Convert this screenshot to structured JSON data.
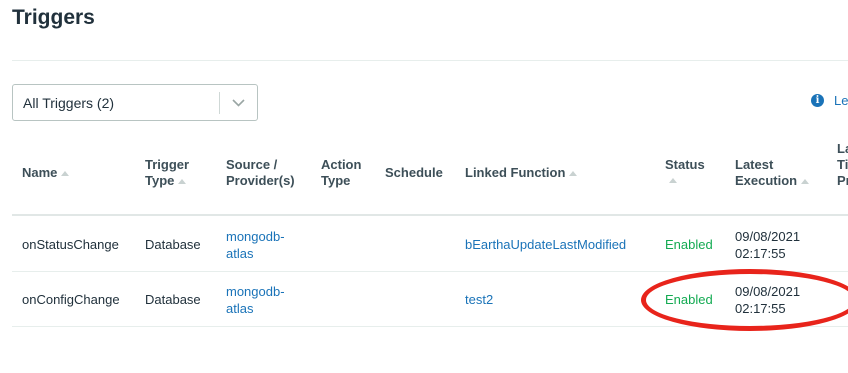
{
  "page": {
    "title": "Triggers"
  },
  "filter": {
    "selected": "All Triggers (2)"
  },
  "info": {
    "link_text": "Le"
  },
  "table": {
    "columns": {
      "name": "Name",
      "trigger_type": [
        "Trigger",
        "Type"
      ],
      "source": [
        "Source /",
        "Provider(s)"
      ],
      "action_type": [
        "Action",
        "Type"
      ],
      "schedule": "Schedule",
      "linked_function": "Linked Function",
      "status": "Status",
      "latest_execution": [
        "Latest",
        "Execution"
      ],
      "last_col": [
        "La",
        "Ti",
        "Pr"
      ]
    },
    "rows": [
      {
        "name": "onStatusChange",
        "type": "Database",
        "source": [
          "mongodb-",
          "atlas"
        ],
        "action_type": "",
        "schedule": "",
        "linked_function": "bEarthaUpdateLastModified",
        "status": "Enabled",
        "latest_execution": [
          "09/08/2021",
          "02:17:55"
        ]
      },
      {
        "name": "onConfigChange",
        "type": "Database",
        "source": [
          "mongodb-",
          "atlas"
        ],
        "action_type": "",
        "schedule": "",
        "linked_function": "test2",
        "status": "Enabled",
        "latest_execution": [
          "09/08/2021",
          "02:17:55"
        ]
      }
    ]
  },
  "colors": {
    "link": "#1a73b8",
    "enabled": "#13aa52",
    "annotation": "#e8241b"
  },
  "icons": {
    "dropdown": "chevron-down-icon",
    "info": "info-icon"
  }
}
